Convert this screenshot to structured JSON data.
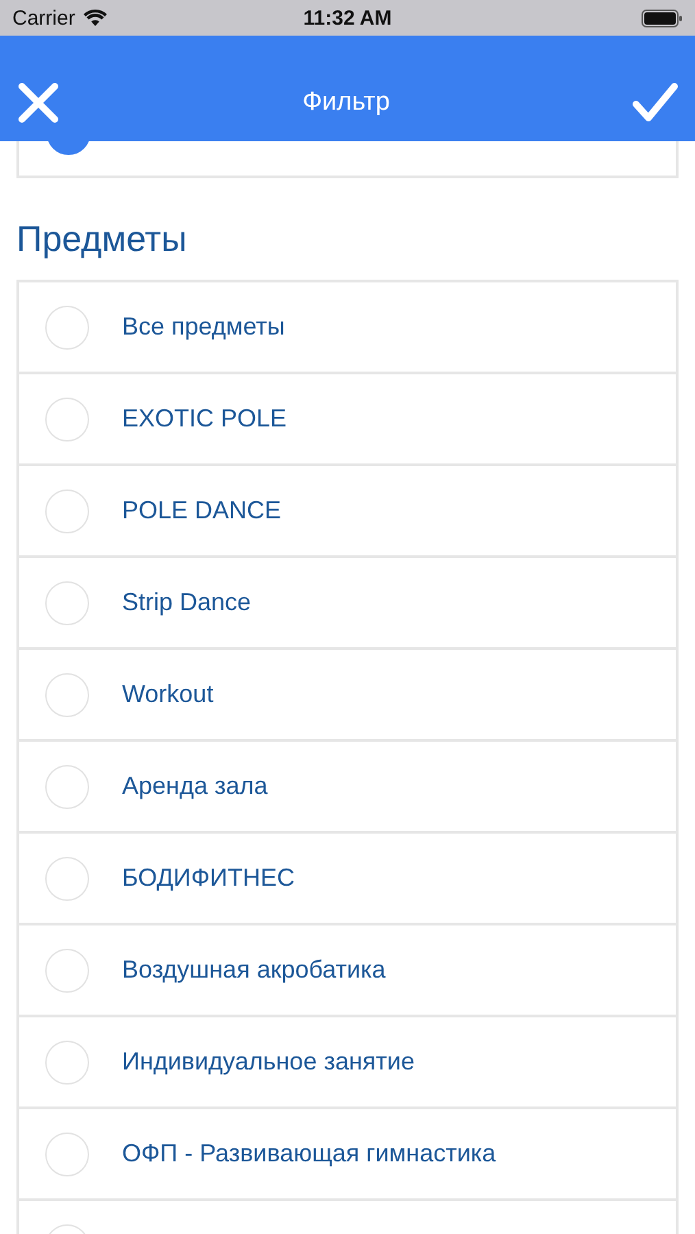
{
  "status_bar": {
    "carrier": "Carrier",
    "time": "11:32 AM"
  },
  "nav_bar": {
    "title": "Фильтр"
  },
  "top_partial_row": {
    "selected": true
  },
  "section": {
    "title": "Предметы"
  },
  "items": [
    {
      "label": "Все предметы",
      "selected": false
    },
    {
      "label": "EXOTIC POLE",
      "selected": false
    },
    {
      "label": "POLE DANCE",
      "selected": false
    },
    {
      "label": "Strip Dance",
      "selected": false
    },
    {
      "label": "Workout",
      "selected": false
    },
    {
      "label": "Аренда зала",
      "selected": false
    },
    {
      "label": "БОДИФИТНЕС",
      "selected": false
    },
    {
      "label": "Воздушная акробатика",
      "selected": false
    },
    {
      "label": "Индивидуальное занятие",
      "selected": false
    },
    {
      "label": "ОФП - Развивающая гимнастика",
      "selected": false
    }
  ],
  "bottom_partial_row": {
    "selected": false
  }
}
